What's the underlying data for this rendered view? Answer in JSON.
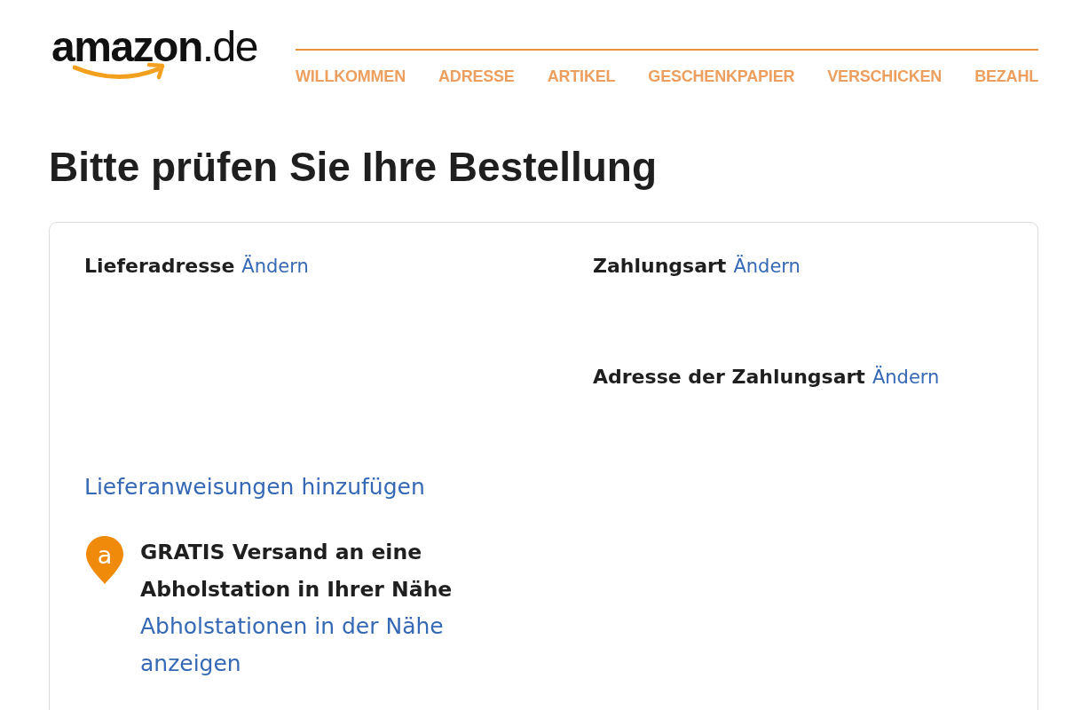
{
  "logo": {
    "wordmark": "**amazon**.de"
  },
  "progress_steps": [
    "WILLKOMMEN",
    "ADRESSE",
    "ARTIKEL",
    "GESCHENKPAPIER",
    "VERSCHICKEN",
    "BEZAHL"
  ],
  "heading": "Bitte prüfen Sie Ihre Bestellung",
  "delivery": {
    "title": "Lieferadresse",
    "change_link": "Ändern",
    "instructions_link": "Lieferanweisungen hinzufügen",
    "pickup": {
      "badge_letter": "a",
      "title": "GRATIS Versand an eine Abholstation in Ihrer Nähe",
      "link": "Abholstationen in der Nähe anzeigen"
    }
  },
  "payment": {
    "sections": [
      {
        "title": "Zahlungsart",
        "change_link": "Ändern"
      },
      {
        "title": "Adresse der Zahlungsart",
        "change_link": "Ändern"
      }
    ]
  }
}
